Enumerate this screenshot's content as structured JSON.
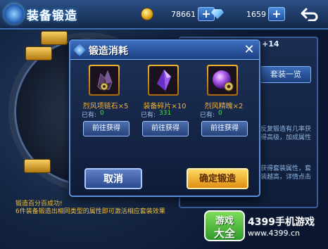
{
  "header": {
    "title": "装备锻造",
    "gold": "78661",
    "diamonds": "1659"
  },
  "background": {
    "level_tag": "+14",
    "set_button": "套装一览",
    "desc_1": "反复锻造有几率获得高级，加成属性",
    "desc_2": "获得套装属性，套装越高，详情点击",
    "tips_1": "锻造百分百成功!",
    "tips_2": "6件装备锻造出相同类型的属性即可激活相应套装效果"
  },
  "dialog": {
    "title": "锻造消耗",
    "owned_label": "已有:",
    "items": [
      {
        "name": "烈风项链石×5",
        "owned": "0",
        "button": "前往获得",
        "icon": "dark-crystal-ore-icon"
      },
      {
        "name": "装备碎片×10",
        "owned": "331",
        "button": "前往获得",
        "icon": "purple-shard-icon"
      },
      {
        "name": "烈风精魄×2",
        "owned": "0",
        "button": "前往获得",
        "icon": "purple-orb-icon"
      }
    ],
    "cancel": "取消",
    "confirm": "确定锻造"
  },
  "watermark": {
    "badge_line1": "游戏",
    "badge_line2": "大全",
    "title": "4399手机游戏",
    "url": "www.4399.cn"
  },
  "colors": {
    "accent_blue": "#3d6fc0",
    "gold_text": "#f0b43a",
    "owned_green": "#49e04f",
    "confirm_orange": "#e08f12"
  }
}
